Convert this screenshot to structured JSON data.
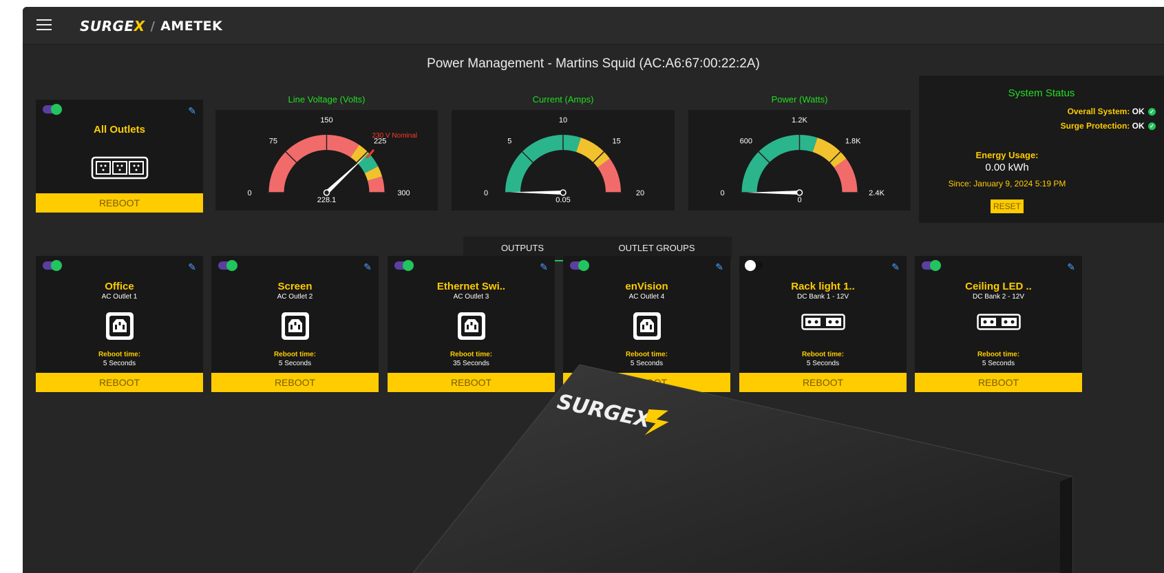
{
  "header": {
    "brand_left": "SURGE",
    "brand_x": "X",
    "brand_sep": "/",
    "brand_right": "AMETEK"
  },
  "page_title": "Power Management - Martins Squid (AC:A6:67:00:22:2A)",
  "all_outlets": {
    "name": "All Outlets",
    "reboot_label": "REBOOT",
    "enabled": true
  },
  "gauges": [
    {
      "title": "Line Voltage (Volts)",
      "ticks": [
        "0",
        "75",
        "150",
        "225",
        "300"
      ],
      "value_label": "228.1",
      "value": 228.1,
      "min": 0,
      "max": 300,
      "note": "230 V Nominal"
    },
    {
      "title": "Current (Amps)",
      "ticks": [
        "0",
        "5",
        "10",
        "15",
        "20"
      ],
      "value_label": "0.05",
      "value": 0.05,
      "min": 0,
      "max": 20
    },
    {
      "title": "Power (Watts)",
      "ticks": [
        "0",
        "600",
        "1.2K",
        "1.8K",
        "2.4K"
      ],
      "value_label": "0",
      "value": 0,
      "min": 0,
      "max": 2400
    }
  ],
  "system_status": {
    "title": "System Status",
    "overall_label": "Overall System:",
    "overall_value": "OK",
    "surge_label": "Surge Protection:",
    "surge_value": "OK"
  },
  "energy": {
    "title": "Energy Usage:",
    "value": "0.00 kWh",
    "since": "Since: January 9, 2024 5:19 PM",
    "reset_label": "RESET"
  },
  "tabs": [
    {
      "label": "OUTPUTS",
      "active": true
    },
    {
      "label": "OUTLET GROUPS",
      "active": false
    }
  ],
  "outlets": [
    {
      "name": "Office",
      "sub": "AC Outlet 1",
      "type": "ac",
      "reboot_time_label": "Reboot time:",
      "reboot_time": "5 Seconds",
      "reboot_label": "REBOOT",
      "enabled": true
    },
    {
      "name": "Screen",
      "sub": "AC Outlet 2",
      "type": "ac",
      "reboot_time_label": "Reboot time:",
      "reboot_time": "5 Seconds",
      "reboot_label": "REBOOT",
      "enabled": true
    },
    {
      "name": "Ethernet Swi..",
      "sub": "AC Outlet 3",
      "type": "ac",
      "reboot_time_label": "Reboot time:",
      "reboot_time": "35 Seconds",
      "reboot_label": "REBOOT",
      "enabled": true
    },
    {
      "name": "enVision",
      "sub": "AC Outlet 4",
      "type": "ac",
      "reboot_time_label": "Reboot time:",
      "reboot_time": "5 Seconds",
      "reboot_label": "REBOOT",
      "enabled": true
    },
    {
      "name": "Rack light 1..",
      "sub": "DC Bank 1 - 12V",
      "type": "dc",
      "reboot_time_label": "Reboot time:",
      "reboot_time": "5 Seconds",
      "reboot_label": "REBOOT",
      "enabled": false
    },
    {
      "name": "Ceiling LED ..",
      "sub": "DC Bank 2 - 12V",
      "type": "dc",
      "reboot_time_label": "Reboot time:",
      "reboot_time": "5 Seconds",
      "reboot_label": "REBOOT",
      "enabled": true
    }
  ],
  "device_logo": "SURGEX",
  "colors": {
    "accent_yellow": "#ffcc00",
    "green": "#21c45d",
    "gauge_red": "#f26b6b",
    "gauge_teal": "#2bb58d",
    "gauge_yellow": "#f2c12e"
  }
}
